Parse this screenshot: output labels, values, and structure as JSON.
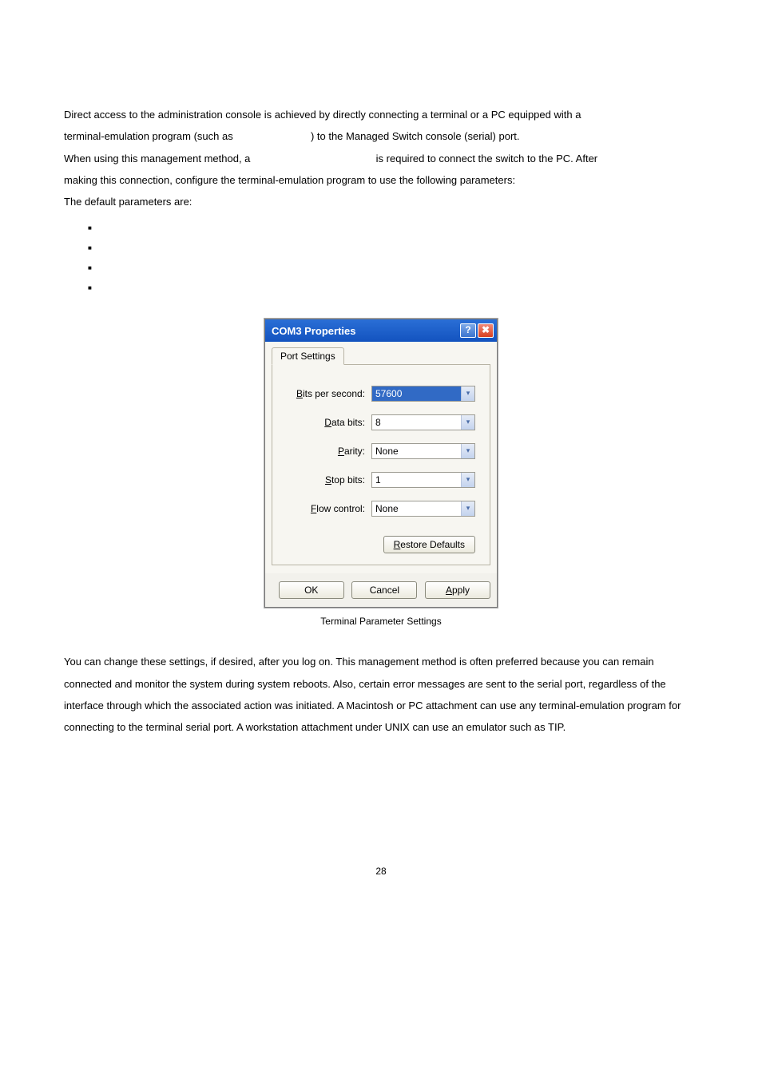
{
  "intro": {
    "p1_a": "Direct access to the administration console is achieved by directly connecting a terminal or a PC equipped with a",
    "p1_b": "terminal-emulation program (such as ",
    "p1_c": ") to the Managed Switch console (serial) port.",
    "p2_a": "When using this management method, a ",
    "p2_b": " is required to connect the switch to the PC. After",
    "p2_c": "making this connection, configure the terminal-emulation program to use the following parameters:",
    "p3": "The default parameters are:"
  },
  "bullets": [
    "",
    "",
    "",
    ""
  ],
  "dialog": {
    "title": "COM3 Properties",
    "help": "?",
    "close": "✖",
    "tab": "Port Settings",
    "fields": {
      "bits_per_second": {
        "label_u": "B",
        "label_rest": "its per second:",
        "value": "57600"
      },
      "data_bits": {
        "label_u": "D",
        "label_rest": "ata bits:",
        "value": "8"
      },
      "parity": {
        "label_u": "P",
        "label_rest": "arity:",
        "value": "None"
      },
      "stop_bits": {
        "label_u": "S",
        "label_rest": "top bits:",
        "value": "1"
      },
      "flow_control": {
        "label_u": "F",
        "label_rest": "low control:",
        "value": "None"
      }
    },
    "restore_u": "R",
    "restore_rest": "estore Defaults",
    "ok": "OK",
    "cancel": "Cancel",
    "apply_u": "A",
    "apply_rest": "pply"
  },
  "caption": "Terminal Parameter Settings",
  "outro": "You can change these settings, if desired, after you log on. This management method is often preferred because you can remain connected and monitor the system during system reboots. Also, certain error messages are sent to the serial port, regardless of the interface through which the associated action was initiated. A Macintosh or PC attachment can use any terminal-emulation program for connecting to the terminal serial port. A workstation attachment under UNIX can use an emulator such as TIP.",
  "page_number": "28"
}
